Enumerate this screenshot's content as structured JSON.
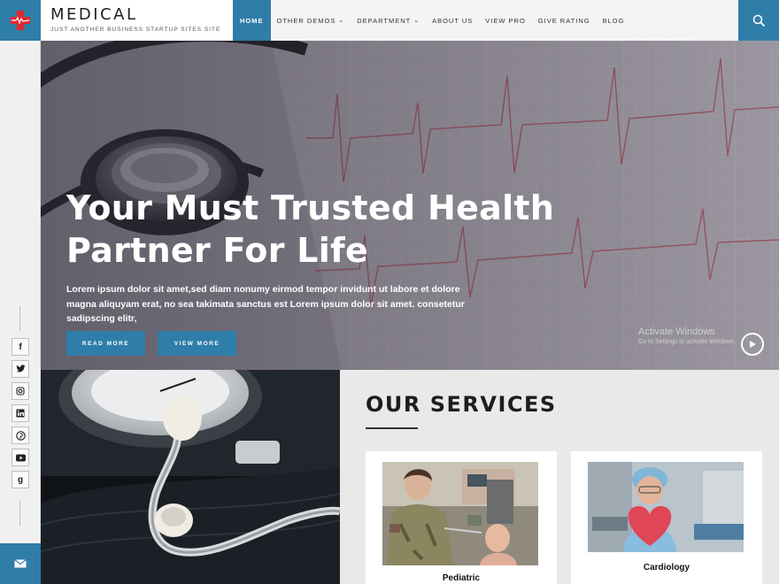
{
  "header": {
    "brand_name": "MEDICAL",
    "brand_tagline": "JUST ANOTHER BUSINESS STARTUP SITES SITE",
    "nav": [
      {
        "label": "HOME",
        "active": true,
        "has_dropdown": false
      },
      {
        "label": "OTHER DEMOS",
        "active": false,
        "has_dropdown": true
      },
      {
        "label": "DEPARTMENT",
        "active": false,
        "has_dropdown": true
      },
      {
        "label": "ABOUT US",
        "active": false,
        "has_dropdown": false
      },
      {
        "label": "VIEW PRO",
        "active": false,
        "has_dropdown": false
      },
      {
        "label": "GIVE RATING",
        "active": false,
        "has_dropdown": false
      },
      {
        "label": "BLOG",
        "active": false,
        "has_dropdown": false
      }
    ],
    "search_icon": "search-icon"
  },
  "sidebar": {
    "social": [
      {
        "name": "facebook-icon",
        "glyph": "f"
      },
      {
        "name": "twitter-icon",
        "glyph": "t"
      },
      {
        "name": "instagram-icon",
        "glyph": "ig"
      },
      {
        "name": "linkedin-icon",
        "glyph": "in"
      },
      {
        "name": "pinterest-icon",
        "glyph": "p"
      },
      {
        "name": "youtube-icon",
        "glyph": "yt"
      },
      {
        "name": "google-plus-icon",
        "glyph": "g"
      }
    ],
    "mail_icon": "mail-icon"
  },
  "hero": {
    "title_line1": "Your Must Trusted Health",
    "title_line2": "Partner For Life",
    "text": "Lorem ipsum dolor sit amet,sed diam nonumy eirmod tempor invidunt ut labore et dolore magna aliquyam erat, no sea takimata sanctus est Lorem ipsum dolor sit amet. consetetur sadipscing elitr,",
    "button_read": "READ MORE",
    "button_view": "VIEW MORE",
    "watermark_title": "Activate Windows",
    "watermark_sub": "Go to Settings to activate Windows."
  },
  "services": {
    "title": "OUR SERVICES",
    "cards": [
      {
        "label": "Pediatric"
      },
      {
        "label": "Cardiology"
      }
    ]
  },
  "colors": {
    "accent": "#2f7ea9",
    "logo_red": "#e3262f"
  }
}
